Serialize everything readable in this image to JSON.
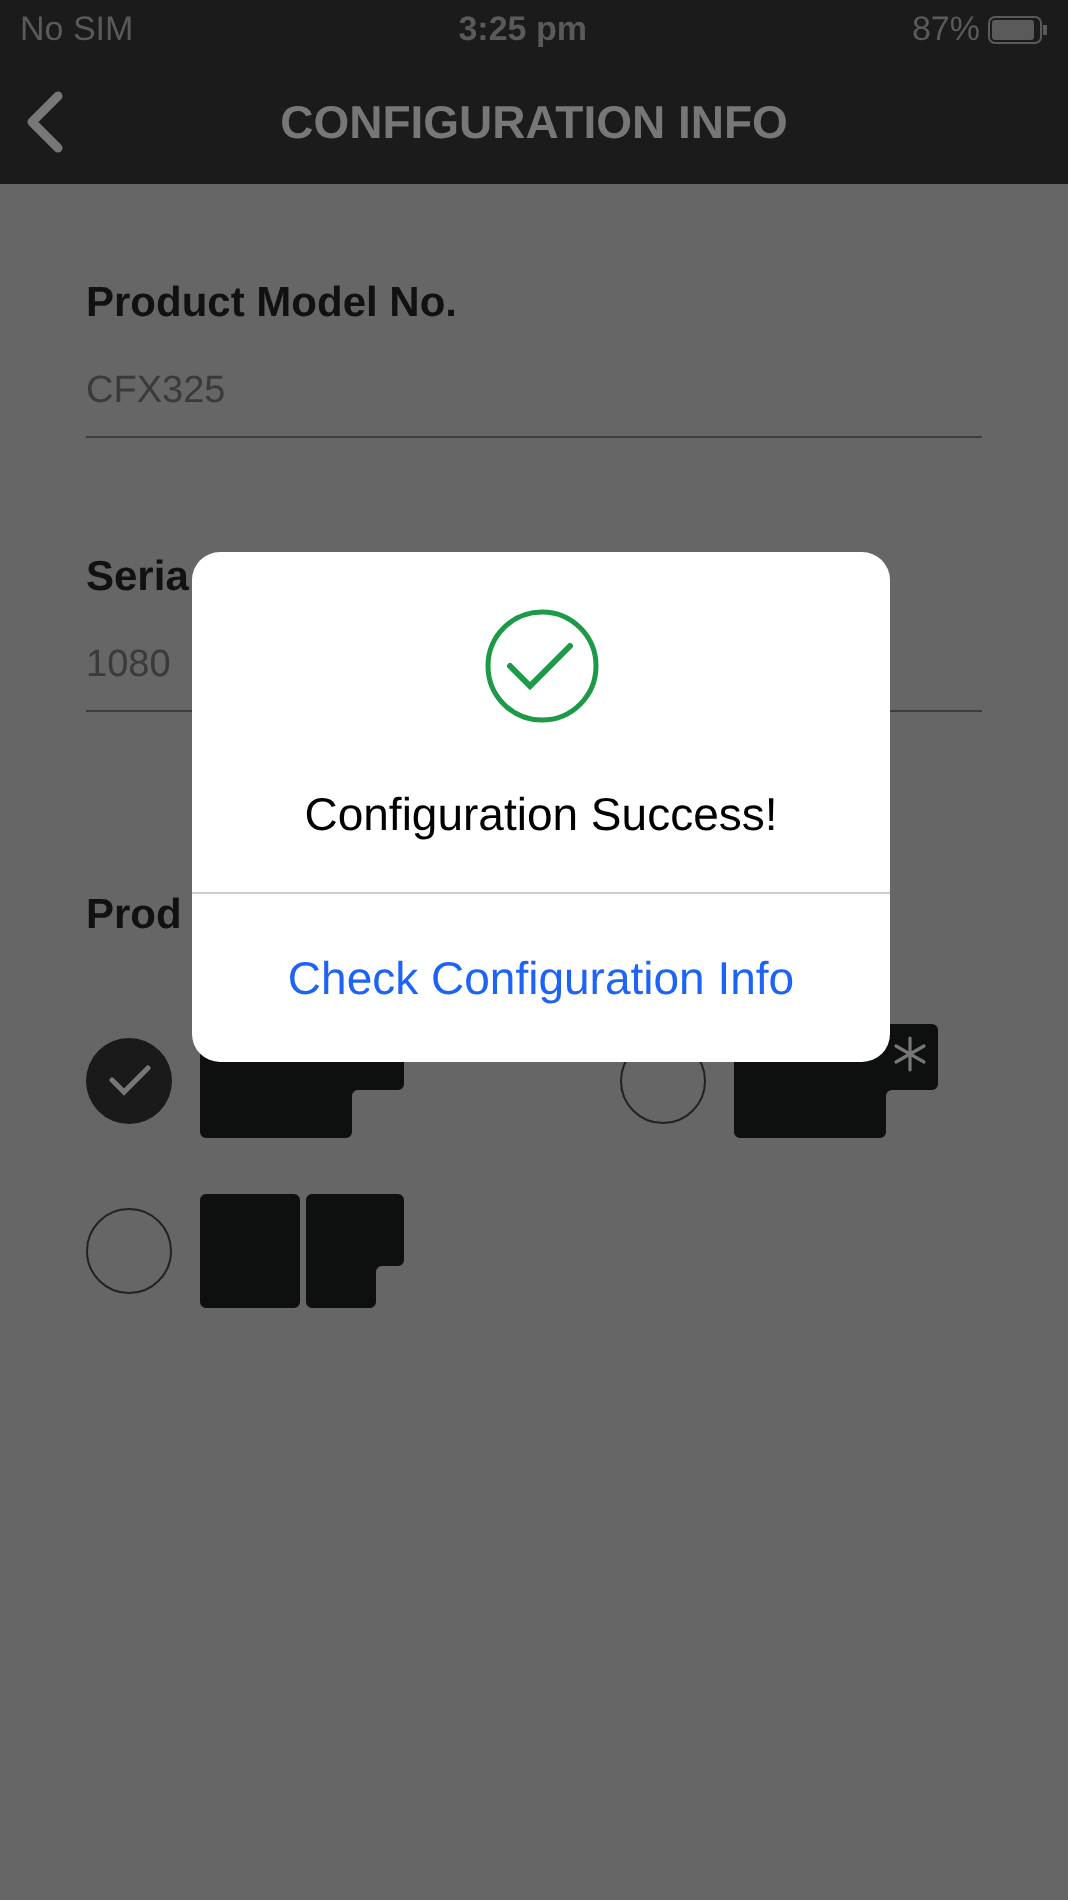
{
  "status_bar": {
    "carrier": "No SIM",
    "time": "3:25 pm",
    "battery": "87%"
  },
  "nav": {
    "title": "CONFIGURATION INFO"
  },
  "fields": [
    {
      "label": "Product Model No.",
      "value": "CFX325"
    },
    {
      "label": "Seria",
      "value": "1080"
    }
  ],
  "product_type": {
    "label": "Prod",
    "options": [
      {
        "kind": "single",
        "selected": true
      },
      {
        "kind": "freezer",
        "selected": false
      },
      {
        "kind": "dual",
        "selected": false
      }
    ]
  },
  "dialog": {
    "message": "Configuration Success!",
    "action": "Check Configuration Info"
  }
}
